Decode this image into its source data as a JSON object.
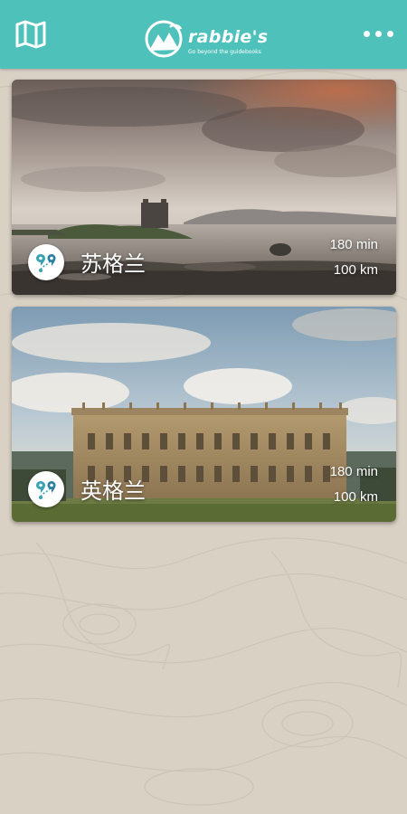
{
  "header": {
    "logo_text": "rabbie's",
    "logo_tagline": "Go beyond the guidebooks",
    "map_icon": "map-icon",
    "menu_icon": "more-dots-icon",
    "background_color": "#4fc1bb"
  },
  "routes": [
    {
      "name": "苏格兰",
      "duration": "180 min",
      "distance": "100 km",
      "icon": "route-pins-icon"
    },
    {
      "name": "英格兰",
      "duration": "180 min",
      "distance": "100 km",
      "icon": "route-pins-icon"
    }
  ]
}
